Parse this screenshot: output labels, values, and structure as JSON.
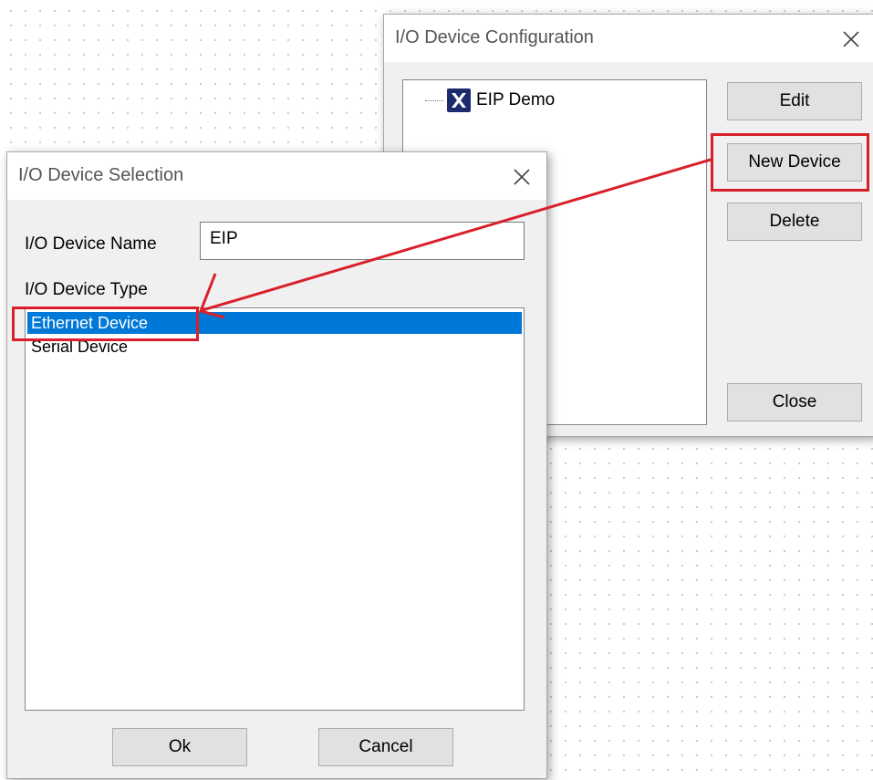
{
  "config_dialog": {
    "title": "I/O Device Configuration",
    "tree_item": "EIP Demo",
    "tree_icon": "x-app-icon",
    "buttons": {
      "edit": "Edit",
      "new_device": "New Device",
      "delete": "Delete",
      "close": "Close"
    }
  },
  "selection_dialog": {
    "title": "I/O Device Selection",
    "name_label": "I/O Device Name",
    "name_value": "EIP",
    "type_label": "I/O Device Type",
    "types": [
      "Ethernet Device",
      "Serial Device"
    ],
    "selected_type": "Ethernet Device",
    "ok_label": "Ok",
    "cancel_label": "Cancel"
  },
  "colors": {
    "annotation_red": "#d9202a",
    "selection_blue": "#0078d7",
    "icon_navy": "#1c2b6e"
  }
}
